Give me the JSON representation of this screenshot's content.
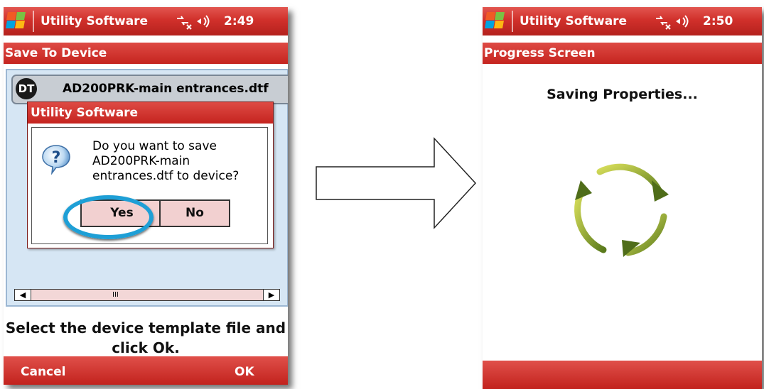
{
  "left_screen": {
    "status": {
      "app_title": "Utility Software",
      "time": "2:49"
    },
    "title_bar": "Save To Device",
    "file_item": {
      "icon_label": "DT",
      "name": "AD200PRK-main entrances.dtf"
    },
    "dialog": {
      "title": "Utility Software",
      "message": "Do you want to save AD200PRK-main entrances.dtf to device?",
      "yes_label": "Yes",
      "no_label": "No"
    },
    "scrollbar_thumb": "III",
    "instruction": "Select the device template file and click Ok.",
    "softkeys": {
      "left": "Cancel",
      "right": "OK"
    }
  },
  "right_screen": {
    "status": {
      "app_title": "Utility Software",
      "time": "2:50"
    },
    "title_bar": "Progress Screen",
    "heading": "Saving Properties..."
  },
  "colors": {
    "accent_red": "#c8231e",
    "highlight_blue": "#1e9fd6",
    "dialog_button_bg": "#f2d0d0",
    "list_bg": "#d6e6f4"
  }
}
